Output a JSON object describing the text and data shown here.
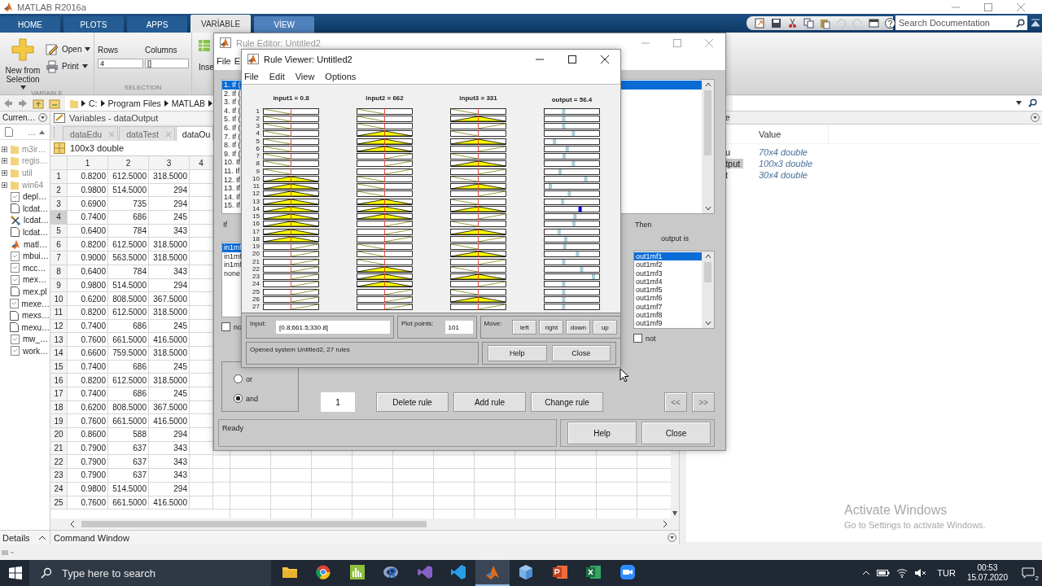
{
  "matlab": {
    "title": "MATLAB R2016a",
    "ribbon_tabs": [
      {
        "label": "HOME",
        "kind": "main",
        "selected": false
      },
      {
        "label": "PLOTS",
        "kind": "main",
        "selected": false
      },
      {
        "label": "APPS",
        "kind": "main",
        "selected": false
      },
      {
        "label": "VARİABLE",
        "kind": "contextual",
        "selected": true
      },
      {
        "label": "VİEW",
        "kind": "contextual",
        "selected": false
      }
    ],
    "search": {
      "placeholder": "Search Documentation"
    },
    "toolstrip": {
      "new_from_selection": "New from Selection",
      "open": "Open",
      "print": "Print",
      "rows_label": "Rows",
      "rows_value": "4",
      "columns_label": "Columns",
      "columns_value": "[]",
      "insert": "Inse",
      "sections": [
        "VARİABLE",
        "SELECTION"
      ]
    },
    "address": [
      "C:",
      "Program Files",
      "MATLAB"
    ],
    "current_folder": {
      "title": "Curren…",
      "column": "…",
      "items": [
        {
          "name": "m3ir…",
          "kind": "folder"
        },
        {
          "name": "regis…",
          "kind": "folder"
        },
        {
          "name": "util",
          "kind": "folder"
        },
        {
          "name": "win64",
          "kind": "folder"
        },
        {
          "name": "depl…",
          "kind": "script"
        },
        {
          "name": "lcdat…",
          "kind": "file"
        },
        {
          "name": "lcdat…",
          "kind": "model"
        },
        {
          "name": "lcdat…",
          "kind": "file"
        },
        {
          "name": "matl…",
          "kind": "app"
        },
        {
          "name": "mbui…",
          "kind": "script"
        },
        {
          "name": "mcc…",
          "kind": "script"
        },
        {
          "name": "mex…",
          "kind": "script"
        },
        {
          "name": "mex.pl",
          "kind": "file"
        },
        {
          "name": "mexe…",
          "kind": "script"
        },
        {
          "name": "mexs…",
          "kind": "file"
        },
        {
          "name": "mexu…",
          "kind": "file"
        },
        {
          "name": "mw_…",
          "kind": "script"
        },
        {
          "name": "work…",
          "kind": "script"
        }
      ]
    },
    "variables": {
      "title": "Variables - dataOutput",
      "tabs": [
        {
          "label": "dataEdu",
          "close": true,
          "selected": false
        },
        {
          "label": "dataTest",
          "close": true,
          "selected": false
        },
        {
          "label": "dataOu",
          "close": false,
          "selected": true
        }
      ],
      "size": "100x3 double",
      "columns": [
        "1",
        "2",
        "3",
        "4"
      ],
      "rows": [
        {
          "n": "1",
          "selected": false,
          "cells": [
            "0.8200",
            "612.5000",
            "318.5000"
          ]
        },
        {
          "n": "2",
          "selected": false,
          "cells": [
            "0.9800",
            "514.5000",
            "294"
          ]
        },
        {
          "n": "3",
          "selected": false,
          "cells": [
            "0.6900",
            "735",
            "294"
          ]
        },
        {
          "n": "4",
          "selected": true,
          "cells": [
            "0.7400",
            "686",
            "245"
          ]
        },
        {
          "n": "5",
          "selected": false,
          "cells": [
            "0.6400",
            "784",
            "343"
          ]
        },
        {
          "n": "6",
          "selected": false,
          "cells": [
            "0.8200",
            "612.5000",
            "318.5000"
          ]
        },
        {
          "n": "7",
          "selected": false,
          "cells": [
            "0.9000",
            "563.5000",
            "318.5000"
          ]
        },
        {
          "n": "8",
          "selected": false,
          "cells": [
            "0.6400",
            "784",
            "343"
          ]
        },
        {
          "n": "9",
          "selected": false,
          "cells": [
            "0.9800",
            "514.5000",
            "294"
          ]
        },
        {
          "n": "10",
          "selected": false,
          "cells": [
            "0.6200",
            "808.5000",
            "367.5000"
          ]
        },
        {
          "n": "11",
          "selected": false,
          "cells": [
            "0.8200",
            "612.5000",
            "318.5000"
          ]
        },
        {
          "n": "12",
          "selected": false,
          "cells": [
            "0.7400",
            "686",
            "245"
          ]
        },
        {
          "n": "13",
          "selected": false,
          "cells": [
            "0.7600",
            "661.5000",
            "416.5000"
          ]
        },
        {
          "n": "14",
          "selected": false,
          "cells": [
            "0.6600",
            "759.5000",
            "318.5000"
          ]
        },
        {
          "n": "15",
          "selected": false,
          "cells": [
            "0.7400",
            "686",
            "245"
          ]
        },
        {
          "n": "16",
          "selected": false,
          "cells": [
            "0.8200",
            "612.5000",
            "318.5000"
          ]
        },
        {
          "n": "17",
          "selected": false,
          "cells": [
            "0.7400",
            "686",
            "245"
          ]
        },
        {
          "n": "18",
          "selected": false,
          "cells": [
            "0.6200",
            "808.5000",
            "367.5000"
          ]
        },
        {
          "n": "19",
          "selected": false,
          "cells": [
            "0.7600",
            "661.5000",
            "416.5000"
          ]
        },
        {
          "n": "20",
          "selected": false,
          "cells": [
            "0.8600",
            "588",
            "294"
          ]
        },
        {
          "n": "21",
          "selected": false,
          "cells": [
            "0.7900",
            "637",
            "343"
          ]
        },
        {
          "n": "22",
          "selected": false,
          "cells": [
            "0.7900",
            "637",
            "343"
          ]
        },
        {
          "n": "23",
          "selected": false,
          "cells": [
            "0.7900",
            "637",
            "343"
          ]
        },
        {
          "n": "24",
          "selected": false,
          "cells": [
            "0.9800",
            "514.5000",
            "294"
          ]
        },
        {
          "n": "25",
          "selected": false,
          "cells": [
            "0.7600",
            "661.5000",
            "416.5000"
          ]
        }
      ]
    },
    "workspace": {
      "title": "e",
      "header": "Value",
      "items": [
        {
          "name": "u",
          "value": "70x4 double",
          "selected": false
        },
        {
          "name": "tput",
          "value": "100x3 double",
          "selected": true
        },
        {
          "name": "t",
          "value": "30x4 double",
          "selected": false
        }
      ]
    },
    "details": "Details",
    "command_window": "Command Window"
  },
  "rule_editor": {
    "title": "Rule Editor: Untitled2",
    "menus": [
      "File",
      "E"
    ],
    "rules": [
      {
        "text": "1. If (",
        "selected": true
      },
      {
        "text": "2. If (",
        "selected": false
      },
      {
        "text": "3. If (",
        "selected": false
      },
      {
        "text": "4. If (",
        "selected": false
      },
      {
        "text": "5. If (",
        "selected": false
      },
      {
        "text": "6. If (",
        "selected": false
      },
      {
        "text": "7. If (",
        "selected": false
      },
      {
        "text": "8. If (",
        "selected": false
      },
      {
        "text": "9. If (",
        "selected": false
      },
      {
        "text": "10. If",
        "selected": false
      },
      {
        "text": "11. If",
        "selected": false
      },
      {
        "text": "12. If",
        "selected": false
      },
      {
        "text": "13. If",
        "selected": false
      },
      {
        "text": "14. If",
        "selected": false
      },
      {
        "text": "15. If",
        "selected": false
      }
    ],
    "if_label": "If",
    "input_list": [
      {
        "label": "in1mf",
        "selected": true
      },
      {
        "label": "in1mf",
        "selected": false
      },
      {
        "label": "in1mf",
        "selected": false
      },
      {
        "label": "none",
        "selected": false
      }
    ],
    "not_left": {
      "label": "no",
      "checked": false
    },
    "connection": [
      {
        "label": "or",
        "selected": false
      },
      {
        "label": "and",
        "selected": true
      }
    ],
    "rule_number": "1",
    "buttons": [
      "Delete rule",
      "Add rule",
      "Change rule"
    ],
    "nav": [
      {
        "label": "<<",
        "disabled": true
      },
      {
        "label": ">>",
        "disabled": true
      }
    ],
    "then_label": "Then",
    "output_label": "output is",
    "output_list": [
      {
        "label": "out1mf1",
        "selected": true
      },
      {
        "label": "out1mf2",
        "selected": false
      },
      {
        "label": "out1mf3",
        "selected": false
      },
      {
        "label": "out1mf4",
        "selected": false
      },
      {
        "label": "out1mf5",
        "selected": false
      },
      {
        "label": "out1mf6",
        "selected": false
      },
      {
        "label": "out1mf7",
        "selected": false
      },
      {
        "label": "out1mf8",
        "selected": false
      },
      {
        "label": "out1mf9",
        "selected": false
      }
    ],
    "not_right": {
      "label": "not",
      "checked": false
    },
    "status": "Ready",
    "bottom_buttons": [
      "Help",
      "Close"
    ]
  },
  "rule_viewer": {
    "title": "Rule Viewer: Untitled2",
    "menus": [
      "File",
      "Edit",
      "View",
      "Options"
    ],
    "headers": [
      "input1 = 0.8",
      "input2 = 662",
      "input3 = 331",
      "output = 56.4"
    ],
    "rules": [
      {
        "number": "1",
        "inputs": [
          {
            "kind": "low"
          },
          {
            "kind": "low"
          },
          {
            "kind": "low"
          }
        ],
        "level": 0.34,
        "highlighted": false
      },
      {
        "number": "2",
        "inputs": [
          {
            "kind": "low"
          },
          {
            "kind": "low"
          },
          {
            "kind": "mid"
          }
        ],
        "level": 0.34,
        "highlighted": false
      },
      {
        "number": "3",
        "inputs": [
          {
            "kind": "low"
          },
          {
            "kind": "low"
          },
          {
            "kind": "high"
          }
        ],
        "level": 0.34,
        "highlighted": false
      },
      {
        "number": "4",
        "inputs": [
          {
            "kind": "low"
          },
          {
            "kind": "mid"
          },
          {
            "kind": "low"
          }
        ],
        "level": 0.53,
        "highlighted": false
      },
      {
        "number": "5",
        "inputs": [
          {
            "kind": "low"
          },
          {
            "kind": "mid"
          },
          {
            "kind": "mid"
          }
        ],
        "level": 0.16,
        "highlighted": false
      },
      {
        "number": "6",
        "inputs": [
          {
            "kind": "low"
          },
          {
            "kind": "mid"
          },
          {
            "kind": "high"
          }
        ],
        "level": 0.41,
        "highlighted": false
      },
      {
        "number": "7",
        "inputs": [
          {
            "kind": "low"
          },
          {
            "kind": "high"
          },
          {
            "kind": "low"
          }
        ],
        "level": 0.35,
        "highlighted": false
      },
      {
        "number": "8",
        "inputs": [
          {
            "kind": "low"
          },
          {
            "kind": "high"
          },
          {
            "kind": "mid"
          }
        ],
        "level": 0.53,
        "highlighted": false
      },
      {
        "number": "9",
        "inputs": [
          {
            "kind": "low"
          },
          {
            "kind": "high"
          },
          {
            "kind": "high"
          }
        ],
        "level": 0.27,
        "highlighted": false
      },
      {
        "number": "10",
        "inputs": [
          {
            "kind": "mid"
          },
          {
            "kind": "low"
          },
          {
            "kind": "low"
          }
        ],
        "level": 0.77,
        "highlighted": false
      },
      {
        "number": "11",
        "inputs": [
          {
            "kind": "mid"
          },
          {
            "kind": "low"
          },
          {
            "kind": "mid"
          }
        ],
        "level": 0.08,
        "highlighted": false
      },
      {
        "number": "12",
        "inputs": [
          {
            "kind": "mid"
          },
          {
            "kind": "low"
          },
          {
            "kind": "high"
          }
        ],
        "level": 0.45,
        "highlighted": false
      },
      {
        "number": "13",
        "inputs": [
          {
            "kind": "mid"
          },
          {
            "kind": "mid"
          },
          {
            "kind": "low"
          }
        ],
        "level": 0.32,
        "highlighted": false
      },
      {
        "number": "14",
        "inputs": [
          {
            "kind": "mid"
          },
          {
            "kind": "mid"
          },
          {
            "kind": "mid"
          }
        ],
        "level": 0.66,
        "highlighted": true
      },
      {
        "number": "15",
        "inputs": [
          {
            "kind": "mid"
          },
          {
            "kind": "mid"
          },
          {
            "kind": "high"
          }
        ],
        "level": 0.56,
        "highlighted": false
      },
      {
        "number": "16",
        "inputs": [
          {
            "kind": "mid"
          },
          {
            "kind": "high"
          },
          {
            "kind": "low"
          }
        ],
        "level": 0.54,
        "highlighted": false
      },
      {
        "number": "17",
        "inputs": [
          {
            "kind": "mid"
          },
          {
            "kind": "high"
          },
          {
            "kind": "mid"
          }
        ],
        "level": 0.25,
        "highlighted": false
      },
      {
        "number": "18",
        "inputs": [
          {
            "kind": "mid"
          },
          {
            "kind": "high"
          },
          {
            "kind": "high"
          }
        ],
        "level": 0.38,
        "highlighted": false
      },
      {
        "number": "19",
        "inputs": [
          {
            "kind": "high"
          },
          {
            "kind": "low"
          },
          {
            "kind": "low"
          }
        ],
        "level": 0.36,
        "highlighted": false
      },
      {
        "number": "20",
        "inputs": [
          {
            "kind": "high"
          },
          {
            "kind": "low"
          },
          {
            "kind": "mid"
          }
        ],
        "level": 0.61,
        "highlighted": false
      },
      {
        "number": "21",
        "inputs": [
          {
            "kind": "high"
          },
          {
            "kind": "low"
          },
          {
            "kind": "high"
          }
        ],
        "level": 0.34,
        "highlighted": false
      },
      {
        "number": "22",
        "inputs": [
          {
            "kind": "high"
          },
          {
            "kind": "mid"
          },
          {
            "kind": "low"
          }
        ],
        "level": 0.69,
        "highlighted": false
      },
      {
        "number": "23",
        "inputs": [
          {
            "kind": "high"
          },
          {
            "kind": "mid"
          },
          {
            "kind": "mid"
          }
        ],
        "level": 0.92,
        "highlighted": false
      },
      {
        "number": "24",
        "inputs": [
          {
            "kind": "high"
          },
          {
            "kind": "mid"
          },
          {
            "kind": "high"
          }
        ],
        "level": 0.34,
        "highlighted": false
      },
      {
        "number": "25",
        "inputs": [
          {
            "kind": "high"
          },
          {
            "kind": "high"
          },
          {
            "kind": "low"
          }
        ],
        "level": 0.34,
        "highlighted": false
      },
      {
        "number": "26",
        "inputs": [
          {
            "kind": "high"
          },
          {
            "kind": "high"
          },
          {
            "kind": "mid"
          }
        ],
        "level": 0.34,
        "highlighted": false
      },
      {
        "number": "27",
        "inputs": [
          {
            "kind": "high"
          },
          {
            "kind": "high"
          },
          {
            "kind": "high"
          }
        ],
        "level": 0.34,
        "highlighted": false
      }
    ],
    "input": {
      "label": "Input:",
      "value": "[0.8;661.5;330.8]"
    },
    "plot_points": {
      "label": "Plot points:",
      "value": "101"
    },
    "move": {
      "label": "Move:",
      "buttons": [
        "left",
        "right",
        "down",
        "up"
      ]
    },
    "status": "Opened system Untitled2, 27 rules",
    "buttons": [
      "Help",
      "Close"
    ]
  },
  "taskbar": {
    "search": {
      "placeholder": "Type here to search"
    },
    "apps": [
      {
        "kind": "explorer",
        "selected": false
      },
      {
        "kind": "chrome",
        "selected": false
      },
      {
        "kind": "stats",
        "selected": false
      },
      {
        "kind": "r",
        "selected": false
      },
      {
        "kind": "vs",
        "selected": false
      },
      {
        "kind": "vscode",
        "selected": false
      },
      {
        "kind": "matlab",
        "selected": true
      },
      {
        "kind": "cube",
        "selected": false
      },
      {
        "kind": "powerpoint",
        "selected": false
      },
      {
        "kind": "excel",
        "selected": false
      },
      {
        "kind": "zoom",
        "selected": false
      }
    ],
    "language": "TUR",
    "time": "00:53",
    "date": "15.07.2020",
    "notifications": "2"
  },
  "activation": {
    "title": "Activate Windows",
    "text": "Go to Settings to activate Windows."
  }
}
